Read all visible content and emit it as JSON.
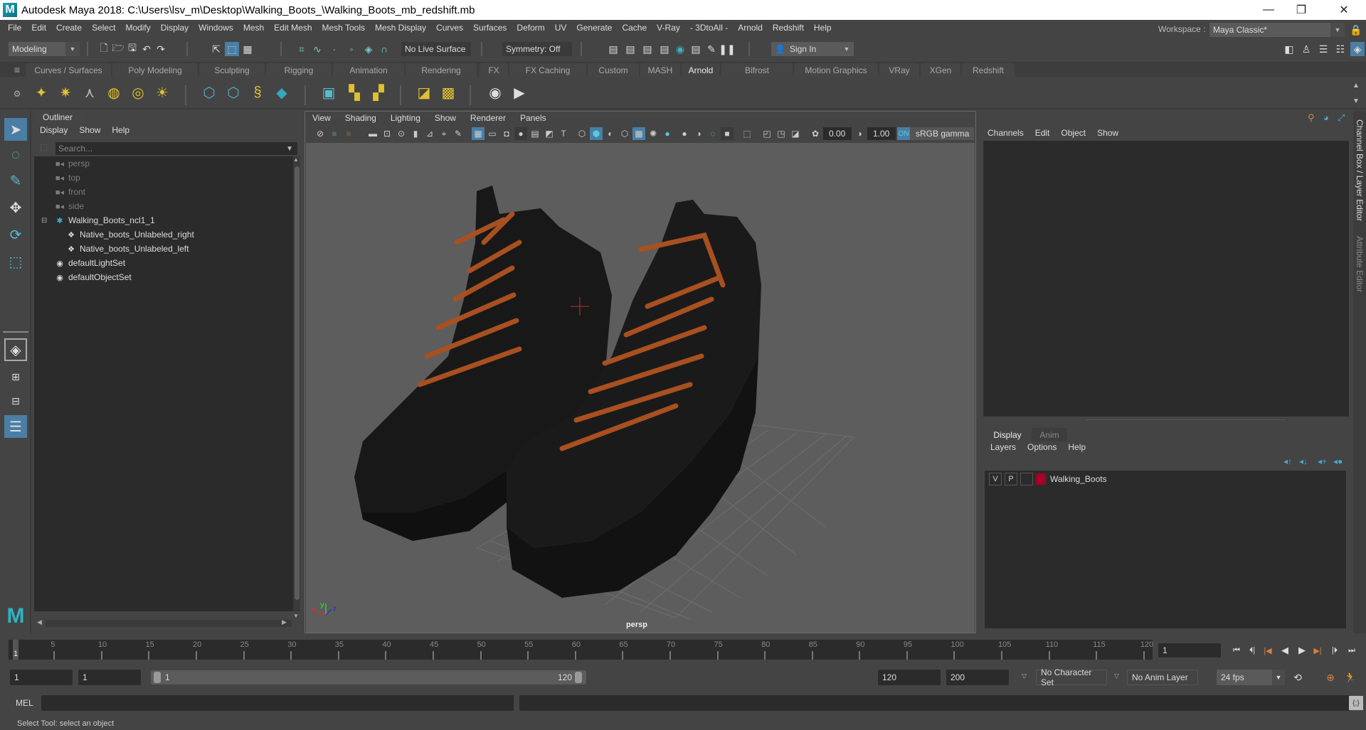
{
  "window": {
    "title": "Autodesk Maya 2018: C:\\Users\\lsv_m\\Desktop\\Walking_Boots_\\Walking_Boots_mb_redshift.mb",
    "logo": "M",
    "minimize": "—",
    "maximize": "❐",
    "close": "✕"
  },
  "menubar": [
    "File",
    "Edit",
    "Create",
    "Select",
    "Modify",
    "Display",
    "Windows",
    "Mesh",
    "Edit Mesh",
    "Mesh Tools",
    "Mesh Display",
    "Curves",
    "Surfaces",
    "Deform",
    "UV",
    "Generate",
    "Cache",
    "V-Ray",
    "- 3DtoAll -",
    "Arnold",
    "Redshift",
    "Help"
  ],
  "statusline": {
    "mode": "Modeling",
    "live_surface": "No Live Surface",
    "symmetry": "Symmetry: Off",
    "sign_in": "Sign In",
    "workspace_label": "Workspace :",
    "workspace_value": "Maya Classic*"
  },
  "shelf": {
    "tabs": [
      "Curves / Surfaces",
      "Poly Modeling",
      "Sculpting",
      "Rigging",
      "Animation",
      "Rendering",
      "FX",
      "FX Caching",
      "Custom",
      "MASH",
      "Arnold",
      "Bifrost",
      "Motion Graphics",
      "VRay",
      "XGen",
      "Redshift"
    ],
    "active_tab": "Arnold"
  },
  "outliner": {
    "title": "Outliner",
    "menu": [
      "Display",
      "Show",
      "Help"
    ],
    "search_placeholder": "Search...",
    "items": [
      {
        "label": "persp",
        "type": "camera",
        "dim": true
      },
      {
        "label": "top",
        "type": "camera",
        "dim": true
      },
      {
        "label": "front",
        "type": "camera",
        "dim": true
      },
      {
        "label": "side",
        "type": "camera",
        "dim": true
      },
      {
        "label": "Walking_Boots_ncl1_1",
        "type": "group",
        "dim": false
      },
      {
        "label": "Native_boots_Unlabeled_right",
        "type": "mesh",
        "dim": false
      },
      {
        "label": "Native_boots_Unlabeled_left",
        "type": "mesh",
        "dim": false
      },
      {
        "label": "defaultLightSet",
        "type": "set",
        "dim": false
      },
      {
        "label": "defaultObjectSet",
        "type": "set",
        "dim": false
      }
    ]
  },
  "viewport": {
    "menu": [
      "View",
      "Shading",
      "Lighting",
      "Show",
      "Renderer",
      "Panels"
    ],
    "exposure": "0.00",
    "gamma": "1.00",
    "color_space": "sRGB gamma",
    "camera_label": "persp",
    "axis": {
      "x": "x",
      "y": "y",
      "z": "z"
    }
  },
  "channel_box": {
    "menu": [
      "Channels",
      "Edit",
      "Object",
      "Show"
    ]
  },
  "layer_editor": {
    "tabs": [
      "Display",
      "Anim"
    ],
    "active_tab": "Display",
    "menu": [
      "Layers",
      "Options",
      "Help"
    ],
    "layers": [
      {
        "v": "V",
        "p": "P",
        "name": "Walking_Boots",
        "color": "#a3002a"
      }
    ]
  },
  "side_tabs": [
    "Channel Box / Layer Editor",
    "Attribute Editor"
  ],
  "timeline": {
    "ticks": [
      5,
      10,
      15,
      20,
      25,
      30,
      35,
      40,
      45,
      50,
      55,
      60,
      65,
      70,
      75,
      80,
      85,
      90,
      95,
      100,
      105,
      110,
      115,
      120
    ],
    "min": 1,
    "max": 120,
    "current_frame": "1",
    "current_frame_field": "1"
  },
  "range": {
    "start": "1",
    "anim_start": "1",
    "slider_start": "1",
    "slider_end": "120",
    "anim_end": "120",
    "end": "200",
    "character_set": "No Character Set",
    "anim_layer": "No Anim Layer",
    "fps": "24 fps"
  },
  "command_line": {
    "label": "MEL"
  },
  "help_line": "Select Tool: select an object"
}
